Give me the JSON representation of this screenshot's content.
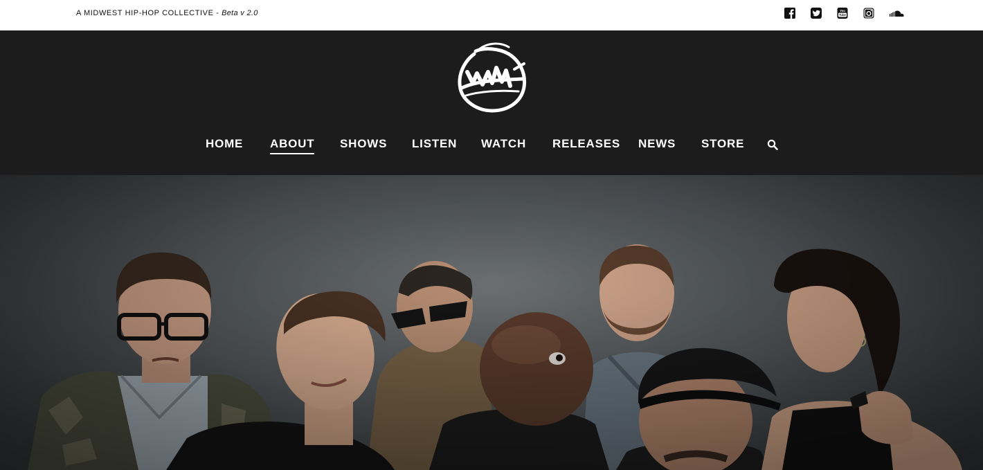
{
  "topbar": {
    "tagline": "A MIDWEST HIP-HOP COLLECTIVE - ",
    "version": "Beta v 2.0"
  },
  "social": [
    {
      "icon": "facebook-icon"
    },
    {
      "icon": "twitter-icon"
    },
    {
      "icon": "youtube-icon"
    },
    {
      "icon": "instagram-icon"
    },
    {
      "icon": "soundcloud-icon"
    }
  ],
  "nav": {
    "items": [
      {
        "label": "HOME"
      },
      {
        "label": "ABOUT",
        "active": true
      },
      {
        "label": "SHOWS"
      },
      {
        "label": "LISTEN"
      },
      {
        "label": "WATCH"
      },
      {
        "label": "RELEASES"
      },
      {
        "label": "NEWS"
      },
      {
        "label": "STORE"
      }
    ],
    "search_icon": "search-icon"
  },
  "colors": {
    "header_bg": "#1c1c1c",
    "topbar_bg": "#ffffff",
    "nav_text": "#ffffff",
    "hero_backdrop": "#5b6063"
  },
  "hero": {
    "image": "group-photo"
  }
}
